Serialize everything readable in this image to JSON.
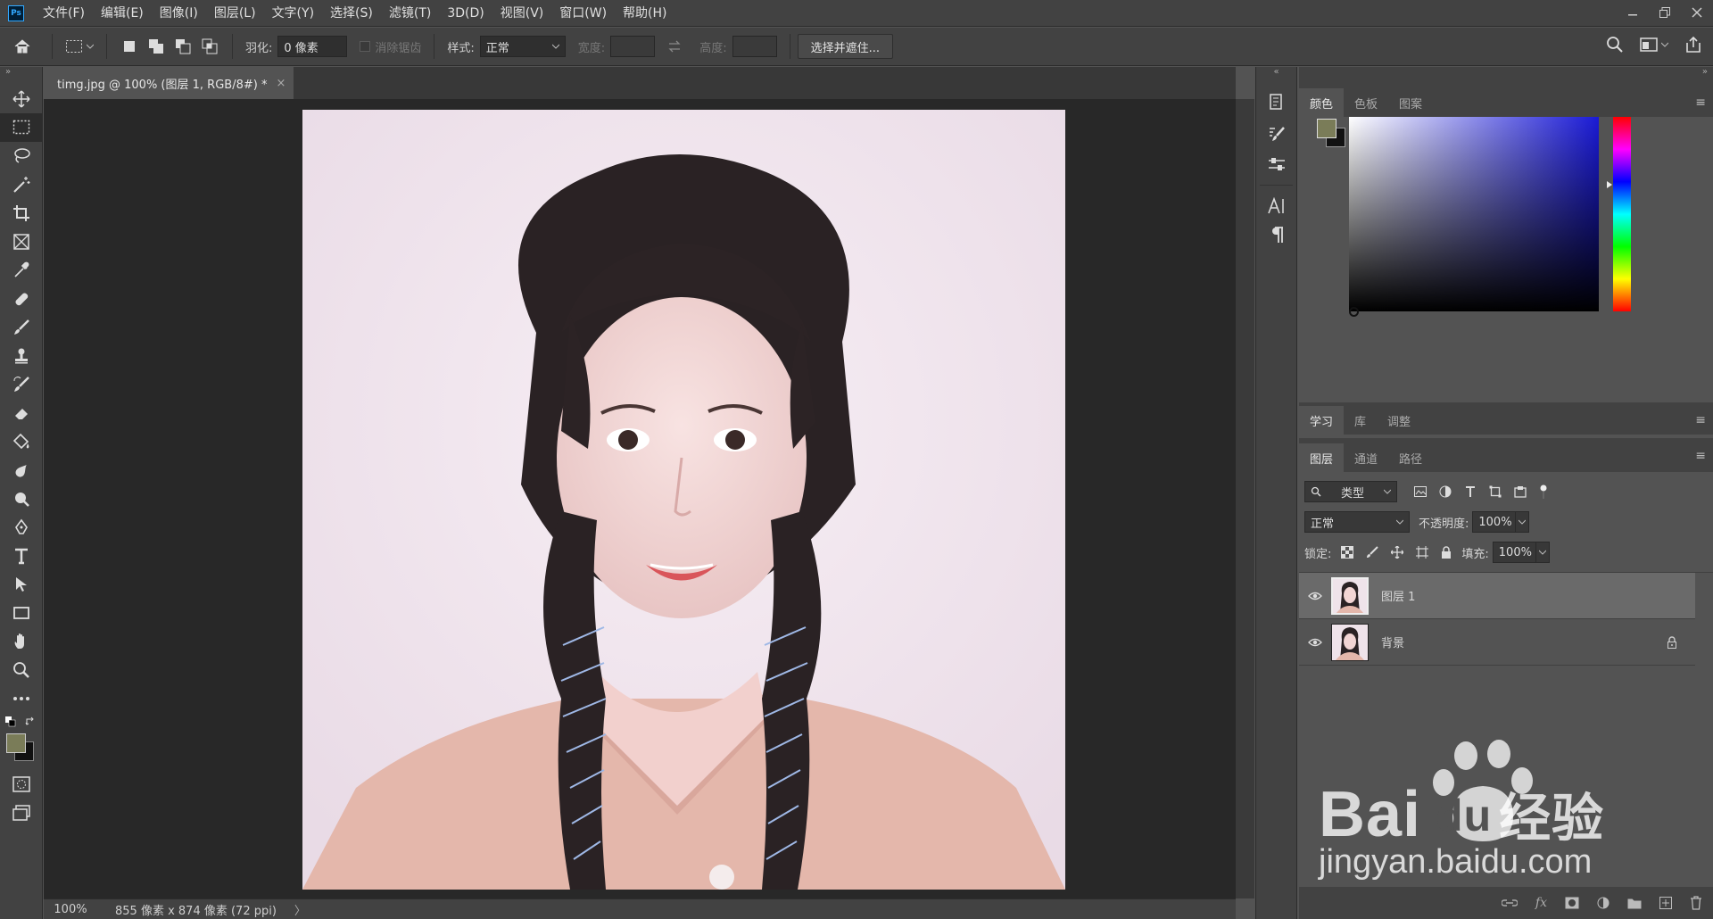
{
  "app": {
    "logo": "Ps",
    "menu": [
      "文件(F)",
      "编辑(E)",
      "图像(I)",
      "图层(L)",
      "文字(Y)",
      "选择(S)",
      "滤镜(T)",
      "3D(D)",
      "视图(V)",
      "窗口(W)",
      "帮助(H)"
    ]
  },
  "options": {
    "feather_label": "羽化:",
    "feather_value": "0 像素",
    "antialias_label": "消除锯齿",
    "style_label": "样式:",
    "style_value": "正常",
    "width_label": "宽度:",
    "height_label": "高度:",
    "select_mask_button": "选择并遮住..."
  },
  "document": {
    "tab_title": "timg.jpg @ 100% (图层 1, RGB/8#) *",
    "close_glyph": "×",
    "zoom": "100%",
    "dimensions": "855 像素 x 874 像素 (72 ppi)",
    "status_arrow": "〉"
  },
  "color_panel": {
    "tabs": [
      "颜色",
      "色板",
      "图案"
    ],
    "foreground": "#7a7c58",
    "background": "#111111",
    "hue_color": "#1a1ad6"
  },
  "learn_panel": {
    "tabs": [
      "学习",
      "库",
      "调整"
    ]
  },
  "layers_panel": {
    "tabs": [
      "图层",
      "通道",
      "路径"
    ],
    "filter_kind": "类型",
    "blend_mode": "正常",
    "opacity_label": "不透明度:",
    "opacity_value": "100%",
    "lock_label": "锁定:",
    "fill_label": "填充:",
    "fill_value": "100%",
    "layers": [
      {
        "name": "图层 1",
        "selected": true,
        "locked": false
      },
      {
        "name": "背景",
        "selected": false,
        "locked": true
      }
    ]
  },
  "watermark": {
    "brand": "Bai",
    "brand_du": "du",
    "brand_cn": "经验",
    "url": "jingyan.baidu.com"
  }
}
